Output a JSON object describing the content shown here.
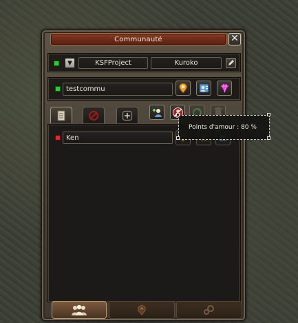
{
  "window": {
    "title": "Communauté",
    "close_label": "✕"
  },
  "header": {
    "status_color": "#22d42a",
    "dropdown_glyph": "▼",
    "project_label": "KSFProject",
    "user_label": "Kuroko",
    "edit_icon": "pencil-icon"
  },
  "community": {
    "name": "testcommu",
    "status_color": "#22d42a",
    "buttons": [
      {
        "icon": "map-pin-icon"
      },
      {
        "icon": "contact-card-icon"
      },
      {
        "icon": "gem-icon"
      }
    ]
  },
  "tabs": [
    {
      "icon": "document-icon",
      "active": true
    },
    {
      "icon": "block-icon",
      "active": false
    },
    {
      "icon": "plus-icon",
      "active": false
    }
  ],
  "actions": [
    {
      "icon": "add-member-icon"
    },
    {
      "icon": "remove-member-icon"
    },
    {
      "icon": "refresh-icon"
    },
    {
      "icon": "trash-icon"
    }
  ],
  "members": [
    {
      "name": "Ken",
      "status_color": "#e02828"
    }
  ],
  "tooltip": {
    "text": "Points d'amour : 80 %"
  },
  "bottom_tabs": [
    {
      "icon": "group-icon",
      "active": true
    },
    {
      "icon": "crest-icon",
      "active": false
    },
    {
      "icon": "gears-icon",
      "active": false
    }
  ]
}
